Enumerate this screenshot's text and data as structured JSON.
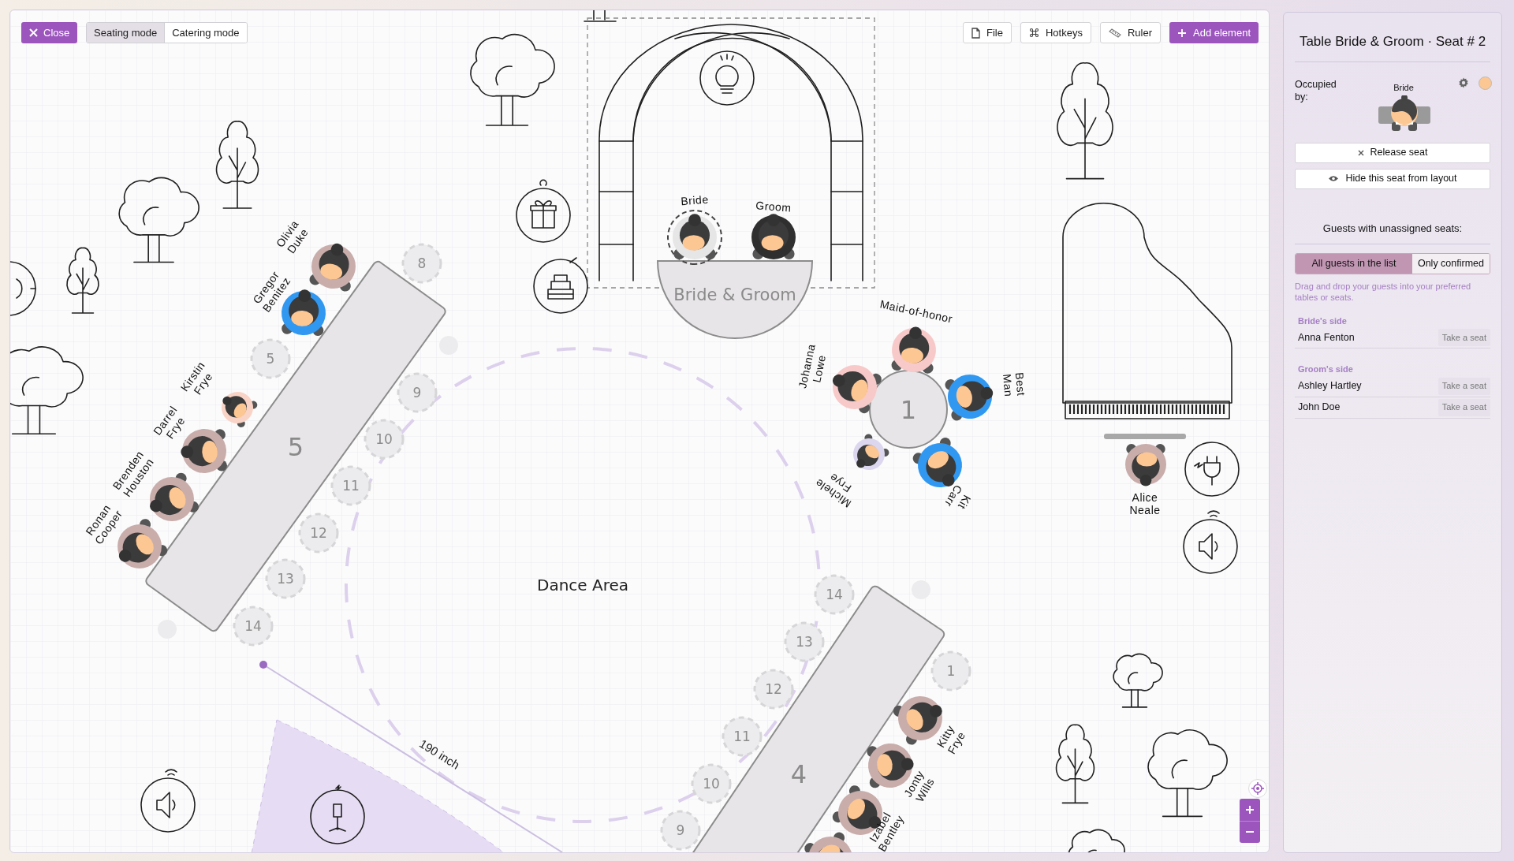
{
  "toolbar": {
    "close": {
      "label": "Close"
    },
    "modes": [
      {
        "label": "Seating mode",
        "selected": true
      },
      {
        "label": "Catering mode",
        "selected": false
      }
    ],
    "actions": [
      {
        "label": "File",
        "kind": "file"
      },
      {
        "label": "Hotkeys",
        "kind": "hotkeys"
      },
      {
        "label": "Ruler",
        "kind": "ruler"
      },
      {
        "label": "Add element",
        "kind": "add"
      }
    ]
  },
  "canvas": {
    "tables": [
      {
        "kind": "head",
        "label": "Bride & Groom",
        "guests": [
          {
            "name": "Bride",
            "color": "#e6e6e6",
            "selected": true
          },
          {
            "name": "Groom",
            "color": "#2f2f2f",
            "selected": false
          }
        ]
      },
      {
        "kind": "round",
        "label": "1",
        "guests": [
          {
            "name": "Maid-of-honor",
            "color": "#f8c9c9",
            "selected": false
          },
          {
            "name": "Johanna Lowe",
            "color": "#f8c9c9",
            "selected": false
          },
          {
            "name": "Best Man",
            "color": "#3198f2",
            "selected": false
          },
          {
            "name": "Kit Carr",
            "color": "#3198f2",
            "selected": false
          },
          {
            "name": "Michele Frye",
            "color": "#dcd6ee",
            "selected": false
          }
        ]
      },
      {
        "kind": "rect",
        "label": "5",
        "empty_seats": [
          "8",
          "5",
          "9",
          "10",
          "11",
          "12",
          "13",
          "14"
        ],
        "guests": [
          {
            "name": "Olivia Duke",
            "color": "#c8adab",
            "selected": false
          },
          {
            "name": "Gregor Benitez",
            "color": "#3198f2",
            "selected": false
          },
          {
            "name": "Kirstin Frye",
            "color": "#f9d4c6",
            "selected": false
          },
          {
            "name": "Darrel Frye",
            "color": "#c8adab",
            "selected": false
          },
          {
            "name": "Brenden Houston",
            "color": "#c8adab",
            "selected": false
          },
          {
            "name": "Ronan Cooper",
            "color": "#c8adab",
            "selected": false
          }
        ]
      },
      {
        "kind": "rect",
        "label": "4",
        "empty_seats": [
          "14",
          "13",
          "12",
          "11",
          "10",
          "9",
          "1"
        ],
        "guests": [
          {
            "name": "Kitty Frye",
            "color": "#c8adab",
            "selected": false
          },
          {
            "name": "Jonty Wills",
            "color": "#c8adab",
            "selected": false
          },
          {
            "name": "Izabel Bentley",
            "color": "#c8adab",
            "selected": false
          },
          {
            "color": "#c8adab",
            "selected": false
          }
        ]
      }
    ],
    "standalone_guests": [
      {
        "name": "Alice Neale",
        "color": "#c8adab",
        "selected": false
      }
    ],
    "dance_area": {
      "label": "Dance Area"
    },
    "ruler": {
      "label": "190 inch"
    }
  },
  "panel": {
    "title": "Table Bride & Groom · Seat # 2",
    "occupied_label": "Occupied by:",
    "occupant": {
      "name": "Bride",
      "color": "#fdc793"
    },
    "buttons": [
      {
        "label": "Release seat",
        "kind": "release"
      },
      {
        "label": "Hide this seat from layout",
        "kind": "hide"
      }
    ],
    "unassigned_title": "Guests with unassigned seats:",
    "filters": [
      {
        "label": "All guests in the list",
        "selected": true
      },
      {
        "label": "Only confirmed",
        "selected": false
      }
    ],
    "hint": "Drag and drop your guests into your preferred tables or seats.",
    "groups": [
      {
        "title": "Bride's side",
        "guests": [
          {
            "name": "Anna Fenton",
            "action": "Take a seat"
          }
        ]
      },
      {
        "title": "Groom's side",
        "guests": [
          {
            "name": "Ashley Hartley",
            "action": "Take a seat"
          },
          {
            "name": "John Doe",
            "action": "Take a seat"
          }
        ]
      }
    ]
  }
}
